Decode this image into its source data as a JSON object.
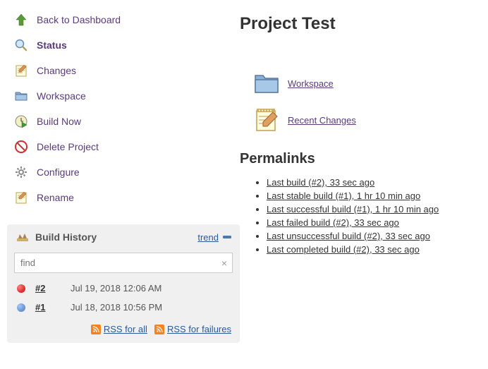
{
  "sidebar": {
    "items": [
      {
        "label": "Back to Dashboard",
        "icon": "up-arrow-icon"
      },
      {
        "label": "Status",
        "icon": "magnifier-icon",
        "bold": true
      },
      {
        "label": "Changes",
        "icon": "notepad-icon"
      },
      {
        "label": "Workspace",
        "icon": "folder-icon"
      },
      {
        "label": "Build Now",
        "icon": "clock-play-icon"
      },
      {
        "label": "Delete Project",
        "icon": "delete-icon"
      },
      {
        "label": "Configure",
        "icon": "gear-icon"
      },
      {
        "label": "Rename",
        "icon": "rename-icon"
      }
    ]
  },
  "build_history": {
    "title": "Build History",
    "trend_label": "trend",
    "search_placeholder": "find",
    "builds": [
      {
        "num": "#2",
        "date": "Jul 19, 2018 12:06 AM",
        "status": "red"
      },
      {
        "num": "#1",
        "date": "Jul 18, 2018 10:56 PM",
        "status": "blue"
      }
    ],
    "rss_all_label": "RSS for all",
    "rss_failures_label": "RSS for failures"
  },
  "main": {
    "title": "Project Test",
    "workspace_label": "Workspace",
    "recent_changes_label": "Recent Changes",
    "permalinks_title": "Permalinks",
    "permalinks": [
      "Last build (#2), 33 sec ago",
      "Last stable build (#1), 1 hr 10 min ago",
      "Last successful build (#1), 1 hr 10 min ago",
      "Last failed build (#2), 33 sec ago",
      "Last unsuccessful build (#2), 33 sec ago",
      "Last completed build (#2), 33 sec ago"
    ]
  }
}
